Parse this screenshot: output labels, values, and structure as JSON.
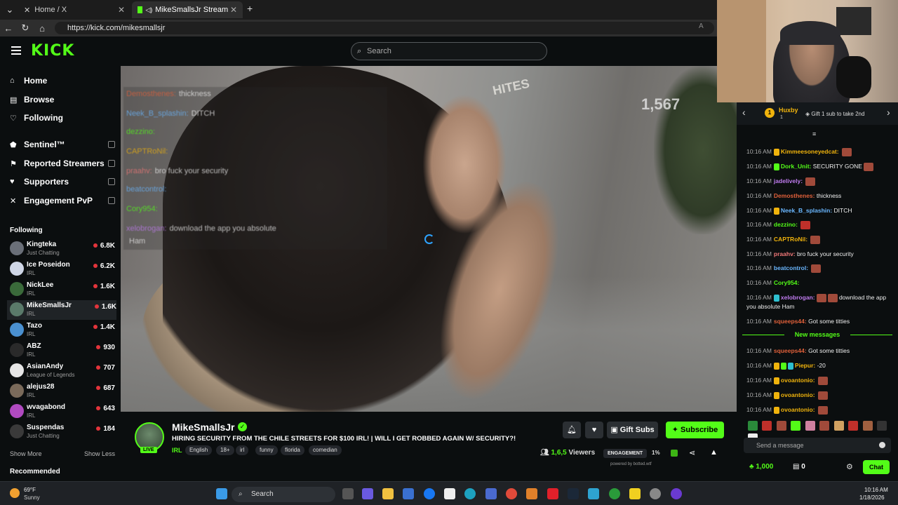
{
  "browser": {
    "tabs": [
      {
        "label": "Home / X"
      },
      {
        "label": "MikeSmallsJr Stream - Watch"
      }
    ],
    "url": "https://kick.com/mikesmallsjr"
  },
  "header": {
    "logo": "KICK",
    "search_placeholder": "Search"
  },
  "sidebar": {
    "nav": [
      {
        "label": "Home",
        "icon": "home-icon"
      },
      {
        "label": "Browse",
        "icon": "browse-icon"
      },
      {
        "label": "Following",
        "icon": "heart-icon"
      }
    ],
    "extensions": [
      {
        "label": "Sentinel™",
        "icon": "shield-icon"
      },
      {
        "label": "Reported Streamers",
        "icon": "flag-icon"
      },
      {
        "label": "Supporters",
        "icon": "heart-icon"
      },
      {
        "label": "Engagement PvP",
        "icon": "swords-icon"
      }
    ],
    "following_title": "Following",
    "following": [
      {
        "name": "Kingteka",
        "category": "Just Chatting",
        "viewers": "6.8K"
      },
      {
        "name": "Ice Poseidon",
        "category": "IRL",
        "viewers": "6.2K"
      },
      {
        "name": "NickLee",
        "category": "IRL",
        "viewers": "1.6K"
      },
      {
        "name": "MikeSmallsJr",
        "category": "IRL",
        "viewers": "1.6K"
      },
      {
        "name": "Tazo",
        "category": "IRL",
        "viewers": "1.4K"
      },
      {
        "name": "ABZ",
        "category": "IRL",
        "viewers": "930"
      },
      {
        "name": "AsianAndy",
        "category": "League of Legends",
        "viewers": "707"
      },
      {
        "name": "alejus28",
        "category": "IRL",
        "viewers": "687"
      },
      {
        "name": "wvagabond",
        "category": "IRL",
        "viewers": "643"
      },
      {
        "name": "Suspendas",
        "category": "Just Chatting",
        "viewers": "184"
      }
    ],
    "show_more": "Show More",
    "show_less": "Show Less",
    "recommended_title": "Recommended"
  },
  "video": {
    "viewer_overlay": "1,567",
    "sign_text": "HITES",
    "overlay_chat": [
      {
        "user": "Demosthenes:",
        "text": "thickness"
      },
      {
        "user": "Neek_B_splashin:",
        "text": "DITCH"
      },
      {
        "user": "dezzino:",
        "text": ""
      },
      {
        "user": "CAPTRoNil:",
        "text": ""
      },
      {
        "user": "praahv:",
        "text": "bro fuck your security"
      },
      {
        "user": "beatcontrol:",
        "text": ""
      },
      {
        "user": "Cory954:",
        "text": ""
      },
      {
        "user": "xelobrogan:",
        "text": "download the app you absolute"
      },
      {
        "user": "",
        "text": "Ham"
      }
    ]
  },
  "stream": {
    "channel": "MikeSmallsJr",
    "live_label": "LIVE",
    "title": "HIRING SECURITY FROM THE CHILE STREETS FOR $100 IRL! | WILL I GET ROBBED AGAIN W/ SECURITY?!",
    "category": "IRL",
    "tags": [
      "English",
      "18+",
      "irl",
      "funny",
      "florida",
      "comedian"
    ],
    "gift_subs": "Gift Subs",
    "subscribe": "Subscribe",
    "viewers": "1,6,5",
    "viewers_label": "Viewers",
    "engagement_label": "ENGAGEMENT",
    "engagement_pct": "1%",
    "powered_by": "powered by botted.wtf"
  },
  "chat": {
    "top_user": "Huxby",
    "top_rank": "1",
    "top_badge": "1",
    "gift_info": "Gift 1 sub to take 2nd",
    "messages": [
      {
        "time": "10:16 AM",
        "user": "Kimmeesoneyedcat:",
        "text": "",
        "color": "#f0b30c",
        "emote": true
      },
      {
        "time": "10:16 AM",
        "user": "Dork_Unit:",
        "text": "SECURITY GONE",
        "color": "#53fc18",
        "emote": true
      },
      {
        "time": "10:16 AM",
        "user": "jadelively:",
        "text": "",
        "color": "#c07cf0",
        "emote": true
      },
      {
        "time": "10:16 AM",
        "user": "Demosthenes:",
        "text": "thickness",
        "color": "#e0603a",
        "emote": false
      },
      {
        "time": "10:16 AM",
        "user": "Neek_B_splashin:",
        "text": "DITCH",
        "color": "#6ab7ff",
        "emote": false
      },
      {
        "time": "10:16 AM",
        "user": "dezzino:",
        "text": "",
        "color": "#53fc18",
        "emote": true
      },
      {
        "time": "10:16 AM",
        "user": "CAPTRoNil:",
        "text": "",
        "color": "#f0b30c",
        "emote": true
      },
      {
        "time": "10:16 AM",
        "user": "praahv:",
        "text": "bro fuck your security",
        "color": "#f07878",
        "emote": false
      },
      {
        "time": "10:16 AM",
        "user": "beatcontrol:",
        "text": "",
        "color": "#6ab7ff",
        "emote": true
      },
      {
        "time": "10:16 AM",
        "user": "Cory954:",
        "text": "",
        "color": "#53fc18",
        "emote": false
      },
      {
        "time": "10:16 AM",
        "user": "xelobrogan:",
        "text": "download the app you absolute Ham",
        "color": "#c07cf0",
        "emote": true
      },
      {
        "time": "10:16 AM",
        "user": "squeeps44:",
        "text": "Got some titties",
        "color": "#e0603a",
        "emote": false
      }
    ],
    "new_messages_label": "New messages",
    "new_messages": [
      {
        "time": "10:16 AM",
        "user": "squeeps44:",
        "text": "Got some titties",
        "color": "#e0603a",
        "emote": false
      },
      {
        "time": "10:16 AM",
        "user": "Piepur:",
        "text": "-20",
        "color": "#f0b30c",
        "emote": false
      },
      {
        "time": "10:16 AM",
        "user": "ovoantonio:",
        "text": "",
        "color": "#f0b30c",
        "emote": true
      },
      {
        "time": "10:16 AM",
        "user": "ovoantonio:",
        "text": "",
        "color": "#f0b30c",
        "emote": true
      },
      {
        "time": "10:16 AM",
        "user": "ovoantonio:",
        "text": "",
        "color": "#f0b30c",
        "emote": true
      }
    ],
    "input_placeholder": "Send a message",
    "points": "1,000",
    "gifts": "0",
    "chat_button": "Chat"
  },
  "taskbar": {
    "temperature": "69°F",
    "weather": "Sunny",
    "search": "Search",
    "time": "10:16 AM",
    "date": "1/18/2026"
  },
  "colors": {
    "brand": "#53fc18",
    "background": "#0b0e0f",
    "live_dot": "#e3343b"
  }
}
